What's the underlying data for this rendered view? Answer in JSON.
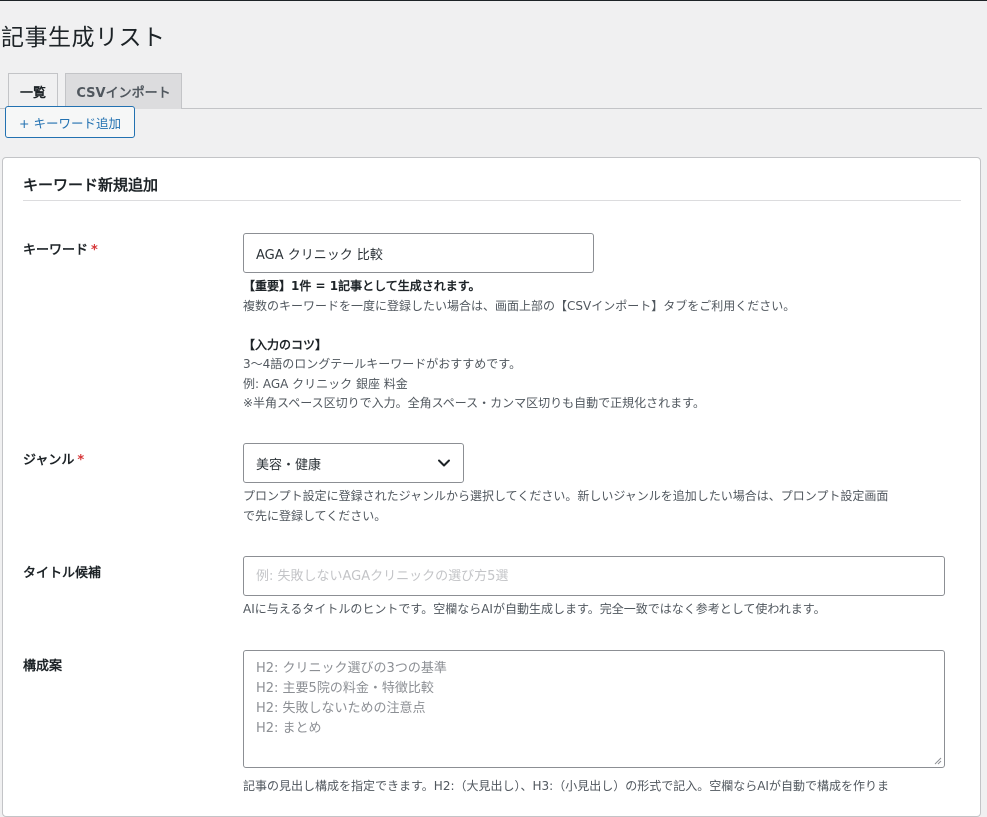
{
  "page": {
    "title": "記事生成リスト"
  },
  "tabs": [
    {
      "label": "一覧"
    },
    {
      "label": "CSVインポート"
    }
  ],
  "add_button": {
    "label": "+ キーワード追加"
  },
  "form": {
    "title": "キーワード新規追加",
    "required_mark": "*",
    "keyword": {
      "label": "キーワード",
      "value": "AGA クリニック 比較",
      "help_important": "【重要】1件 = 1記事として生成されます。",
      "help_line1": "複数のキーワードを一度に登録したい場合は、画面上部の【CSVインポート】タブをご利用ください。",
      "tips_title": "【入力のコツ】",
      "tips_line1": "3〜4語のロングテールキーワードがおすすめです。",
      "tips_line2": "例: AGA クリニック 銀座 料金",
      "tips_line3": "※半角スペース区切りで入力。全角スペース・カンマ区切りも自動で正規化されます。"
    },
    "genre": {
      "label": "ジャンル",
      "selected": "美容・健康",
      "help_line1": "プロンプト設定に登録されたジャンルから選択してください。新しいジャンルを追加したい場合は、プロンプト設定画面",
      "help_line2": "で先に登録してください。"
    },
    "title_candidate": {
      "label": "タイトル候補",
      "placeholder": "例: 失敗しないAGAクリニックの選び方5選",
      "help": "AIに与えるタイトルのヒントです。空欄ならAIが自動生成します。完全一致ではなく参考として使われます。"
    },
    "structure": {
      "label": "構成案",
      "lines": [
        "H2: クリニック選びの3つの基準",
        "H2: 主要5院の料金・特徴比較",
        "H2: 失敗しないための注意点",
        "H2: まとめ"
      ],
      "help": "記事の見出し構成を指定できます。H2:（大見出し）、H3:（小見出し）の形式で記入。空欄ならAIが自動で構成を作りま"
    }
  }
}
